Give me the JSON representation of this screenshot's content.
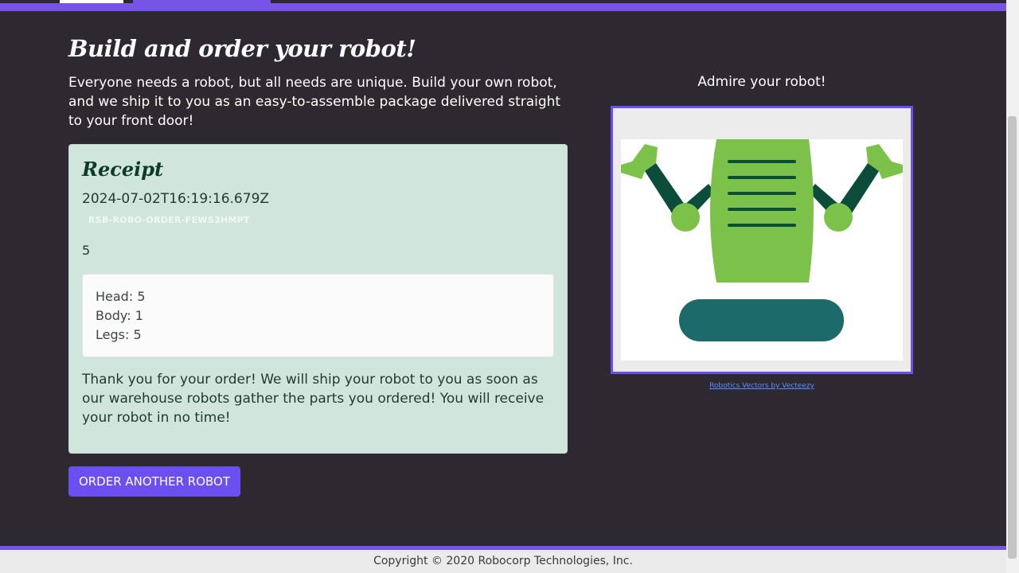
{
  "header": {
    "title": "Build and order your robot!",
    "intro": "Everyone needs a robot, but all needs are unique. Build your own robot, and we ship it to you as an easy-to-assemble package delivered straight to your front door!"
  },
  "receipt": {
    "title": "Receipt",
    "timestamp": "2024-07-02T16:19:16.679Z",
    "order_id": "RSB-ROBO-ORDER-FEWS3HMPT",
    "number": "5",
    "parts": {
      "head": "Head: 5",
      "body": "Body: 1",
      "legs": "Legs: 5"
    },
    "thanks": "Thank you for your order! We will ship your robot to you as soon as our warehouse robots gather the parts you ordered! You will receive your robot in no time!"
  },
  "actions": {
    "order_another_label": "ORDER ANOTHER ROBOT"
  },
  "preview": {
    "caption": "Admire your robot!",
    "credit_link": "Robotics Vectors by Vecteezy"
  },
  "footer": {
    "copyright": "Copyright © 2020 Robocorp Technologies, Inc."
  },
  "colors": {
    "background": "#2e2830",
    "accent": "#6b4ff0",
    "receipt_bg": "#d0e6dc",
    "robot_green": "#7cc14a",
    "robot_dark": "#0b4d3a",
    "robot_teal": "#1c6b6a"
  }
}
